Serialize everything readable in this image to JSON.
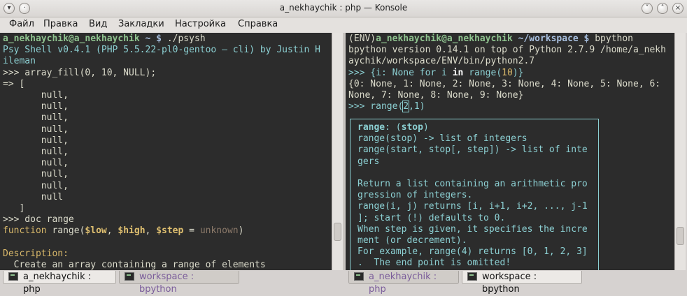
{
  "window": {
    "title": "a_nekhaychik : php — Konsole"
  },
  "menu": [
    "Файл",
    "Правка",
    "Вид",
    "Закладки",
    "Настройка",
    "Справка"
  ],
  "left": {
    "prompt_user": "a_nekhaychik@a_nekhaychik",
    "prompt_rest": " ~ $ ",
    "cmd": "./psysh",
    "banner": "Psy Shell v0.4.1 (PHP 5.5.22-pl0-gentoo — cli) by Justin H\nileman",
    "lines": ">>> array_fill(0, 10, NULL);\n=> [\n       null,\n       null,\n       null,\n       null,\n       null,\n       null,\n       null,\n       null,\n       null,\n       null\n   ]\n>>> doc range",
    "fn_kw": "function",
    "fn_name": " range(",
    "p1": "$low",
    "sep1": ", ",
    "p2": "$high",
    "sep2": ", ",
    "p3": "$step",
    "eq": " = ",
    "def": "unknown",
    "close": ")",
    "desc_label": "Description:",
    "desc_text": "  Create an array containing a range of elements"
  },
  "right": {
    "env": "(ENV)",
    "prompt_user": "a_nekhaychik@a_nekhaychik",
    "prompt_dir": " ~/workspace $ ",
    "cmd": "bpython",
    "version": "bpython version 0.14.1 on top of Python 2.7.9 /home/a_nekh\naychik/workspace/ENV/bin/python2.7",
    "in1_a": ">>> {i: None for i ",
    "in1_kw": "in",
    "in1_b": " range(",
    "in1_num": "10",
    "in1_c": ")}",
    "out1": "{0: None, 1: None, 2: None, 3: None, 4: None, 5: None, 6:\nNone, 7: None, 8: None, 9: None}",
    "in2_a": ">>> range(",
    "in2_cur": "2",
    "in2_b": ",1)",
    "tip_fn": "range",
    "tip_colon": ": (",
    "tip_arg": "stop",
    "tip_end": ")",
    "tip_body": "range(stop) -> list of integers\nrange(start, stop[, step]) -> list of inte\ngers\n\nReturn a list containing an arithmetic pro\ngression of integers.\nrange(i, j) returns [i, i+1, i+2, ..., j-1\n]; start (!) defaults to 0.\nWhen step is given, it specifies the incre\nment (or decrement).\nFor example, range(4) returns [0, 1, 2, 3]\n.  The end point is omitted!"
  },
  "tabs_left": [
    "a_nekhaychik : php",
    "workspace : bpython"
  ],
  "tabs_right": [
    "a_nekhaychik : php",
    "workspace : bpython"
  ]
}
